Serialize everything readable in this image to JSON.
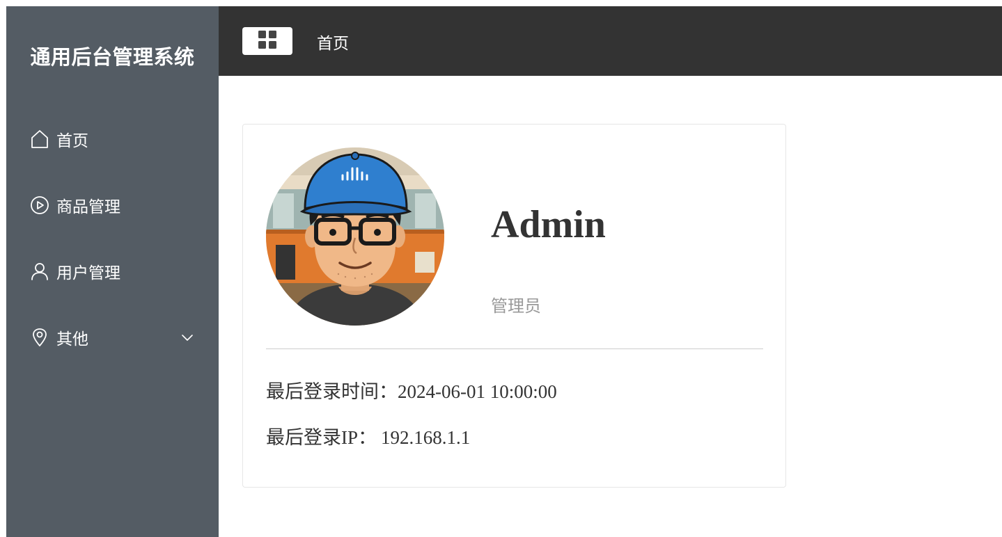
{
  "sidebar": {
    "title": "通用后台管理系统",
    "items": [
      {
        "label": "首页",
        "icon": "home-icon"
      },
      {
        "label": "商品管理",
        "icon": "play-circle-icon"
      },
      {
        "label": "用户管理",
        "icon": "user-icon"
      },
      {
        "label": "其他",
        "icon": "location-icon",
        "submenu_indicator": "chevron-down-icon"
      }
    ]
  },
  "header": {
    "collapse_icon": "grid-menu-icon",
    "breadcrumb": "首页"
  },
  "profile": {
    "name": "Admin",
    "role": "管理员",
    "last_login_time_label": "最后登录时间：",
    "last_login_time": "2024-06-01 10:00:00",
    "last_login_ip_label": "最后登录IP：",
    "last_login_ip": "192.168.1.1"
  },
  "colors": {
    "sidebar_bg": "#545c64",
    "header_bg": "#333333",
    "text_primary": "#333333",
    "text_secondary": "#999999"
  }
}
